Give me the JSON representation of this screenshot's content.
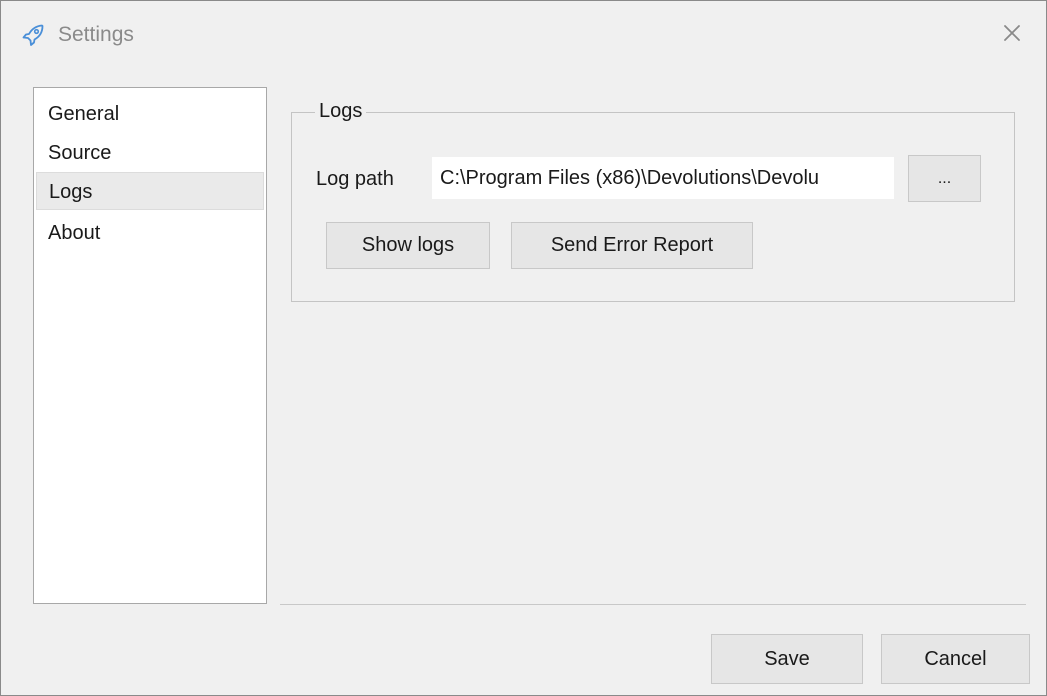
{
  "window": {
    "title": "Settings",
    "icon": "rocket-icon",
    "close_icon": "close-icon"
  },
  "nav": {
    "items": [
      {
        "label": "General",
        "selected": false
      },
      {
        "label": "Source",
        "selected": false
      },
      {
        "label": "Logs",
        "selected": true
      },
      {
        "label": "About",
        "selected": false
      }
    ]
  },
  "logs": {
    "group_title": "Logs",
    "log_path_label": "Log path",
    "log_path_value": "C:\\Program Files (x86)\\Devolutions\\Devolu",
    "browse_label": "...",
    "show_logs_label": "Show logs",
    "send_error_label": "Send Error Report"
  },
  "footer": {
    "save_label": "Save",
    "cancel_label": "Cancel"
  },
  "colors": {
    "background": "#f0f0f0",
    "icon_accent": "#4a8fd8",
    "title_text": "#8a8a8a"
  }
}
